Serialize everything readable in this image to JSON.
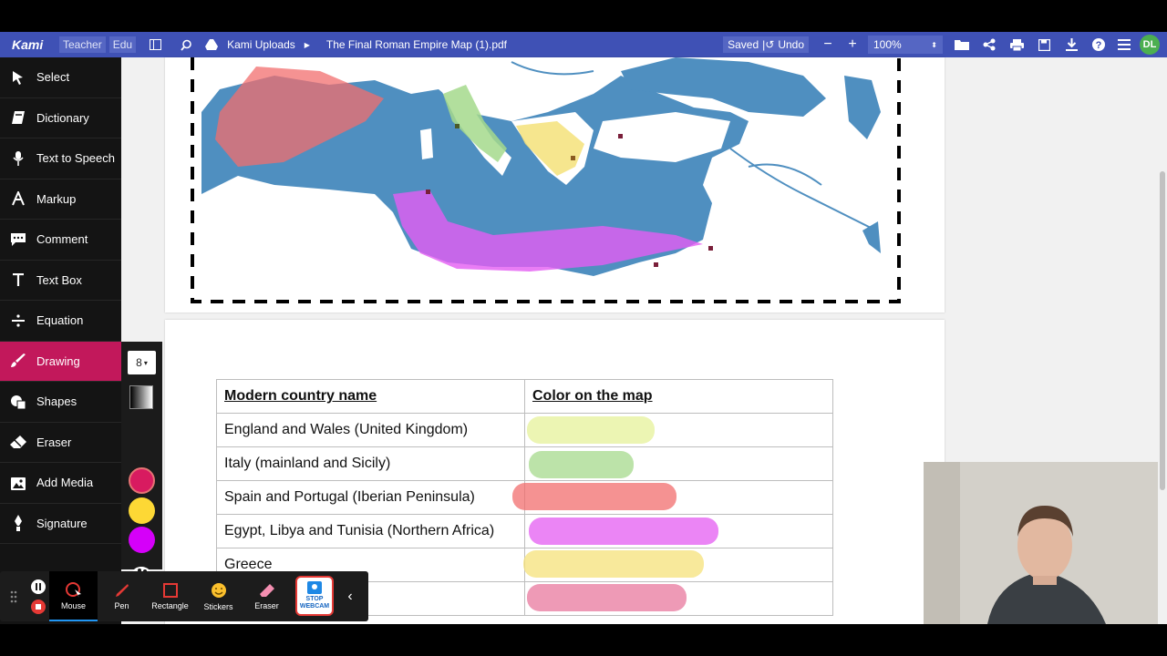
{
  "app": {
    "logo": "Kami",
    "chips": [
      "Teacher",
      "Edu"
    ],
    "breadcrumb": "Kami Uploads",
    "file_name": "The Final Roman Empire Map (1).pdf",
    "saved": "Saved",
    "undo": "Undo",
    "zoom": "100%",
    "avatar": "DL",
    "accent": "#3f51b5"
  },
  "sidebar": {
    "items": [
      {
        "label": "Select",
        "icon": "cursor-icon"
      },
      {
        "label": "Dictionary",
        "icon": "book-icon"
      },
      {
        "label": "Text to Speech",
        "icon": "speaker-icon"
      },
      {
        "label": "Markup",
        "icon": "markup-icon"
      },
      {
        "label": "Comment",
        "icon": "comment-icon"
      },
      {
        "label": "Text Box",
        "icon": "text-icon"
      },
      {
        "label": "Equation",
        "icon": "divide-icon"
      },
      {
        "label": "Drawing",
        "icon": "brush-icon"
      },
      {
        "label": "Shapes",
        "icon": "shapes-icon"
      },
      {
        "label": "Eraser",
        "icon": "eraser-icon"
      },
      {
        "label": "Add Media",
        "icon": "image-icon"
      },
      {
        "label": "Signature",
        "icon": "pen-nib-icon"
      }
    ],
    "active": "Drawing",
    "active_color": "#c2185b"
  },
  "drawing_panel": {
    "size": "8",
    "colors": [
      "#d81b60",
      "#fdd835",
      "#d500f9"
    ]
  },
  "bottom_toolbar": {
    "items": [
      "Mouse",
      "Pen",
      "Rectangle",
      "Stickers",
      "Eraser"
    ],
    "webcam_label": "STOP WEBCAM"
  },
  "table": {
    "headers": [
      "Modern country name",
      "Color on the map"
    ],
    "rows": [
      {
        "name": "England and Wales (United Kingdom)",
        "color": "#e6f29a"
      },
      {
        "name": "Italy (mainland and Sicily)",
        "color": "#a5d98c"
      },
      {
        "name": "Spain and Portugal (Iberian Peninsula)",
        "color": "#f26d6d"
      },
      {
        "name": "Egypt, Libya  and Tunisia (Northern Africa)",
        "color": "#e45cf2"
      },
      {
        "name": "Greece",
        "color": "#f5e27a"
      },
      {
        "name": "",
        "color": "#e8789e"
      }
    ]
  }
}
